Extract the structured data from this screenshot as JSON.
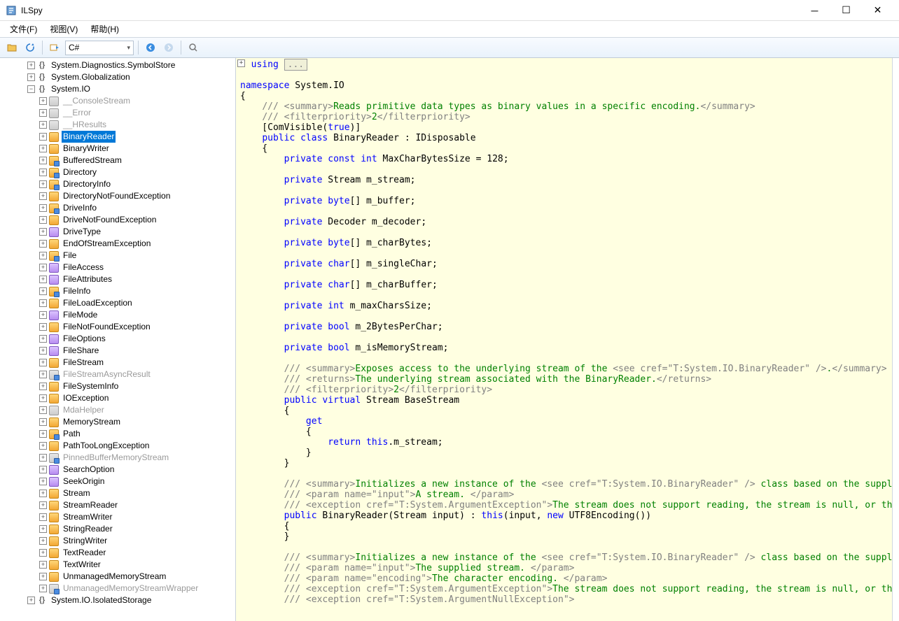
{
  "window": {
    "title": "ILSpy"
  },
  "menu": {
    "file": "文件(F)",
    "view": "视图(V)",
    "help": "帮助(H)"
  },
  "toolbar": {
    "open": "Open",
    "refresh": "Refresh",
    "goto": "Goto",
    "lang_combo": "C#",
    "back": "Back",
    "forward": "Forward",
    "search": "Search"
  },
  "tree": {
    "ns1": "System.Diagnostics.SymbolStore",
    "ns2": "System.Globalization",
    "ns3": "System.IO",
    "ns4": "System.IO.IsolatedStorage",
    "items": [
      {
        "id": "__ConsoleStream",
        "label": "__ConsoleStream",
        "internal": true
      },
      {
        "id": "__Error",
        "label": "__Error",
        "internal": true
      },
      {
        "id": "__HResults",
        "label": "__HResults",
        "internal": true
      },
      {
        "id": "BinaryReader",
        "label": "BinaryReader",
        "selected": true
      },
      {
        "id": "BinaryWriter",
        "label": "BinaryWriter"
      },
      {
        "id": "BufferedStream",
        "label": "BufferedStream",
        "sealed": true
      },
      {
        "id": "Directory",
        "label": "Directory",
        "sealed": true
      },
      {
        "id": "DirectoryInfo",
        "label": "DirectoryInfo",
        "sealed": true
      },
      {
        "id": "DirectoryNotFoundException",
        "label": "DirectoryNotFoundException"
      },
      {
        "id": "DriveInfo",
        "label": "DriveInfo",
        "sealed": true
      },
      {
        "id": "DriveNotFoundException",
        "label": "DriveNotFoundException"
      },
      {
        "id": "DriveType",
        "label": "DriveType",
        "enum": true
      },
      {
        "id": "EndOfStreamException",
        "label": "EndOfStreamException"
      },
      {
        "id": "File",
        "label": "File",
        "sealed": true
      },
      {
        "id": "FileAccess",
        "label": "FileAccess",
        "enum": true
      },
      {
        "id": "FileAttributes",
        "label": "FileAttributes",
        "enum": true
      },
      {
        "id": "FileInfo",
        "label": "FileInfo",
        "sealed": true
      },
      {
        "id": "FileLoadException",
        "label": "FileLoadException"
      },
      {
        "id": "FileMode",
        "label": "FileMode",
        "enum": true
      },
      {
        "id": "FileNotFoundException",
        "label": "FileNotFoundException"
      },
      {
        "id": "FileOptions",
        "label": "FileOptions",
        "enum": true
      },
      {
        "id": "FileShare",
        "label": "FileShare",
        "enum": true
      },
      {
        "id": "FileStream",
        "label": "FileStream"
      },
      {
        "id": "FileStreamAsyncResult",
        "label": "FileStreamAsyncResult",
        "internal": true,
        "sealed": true
      },
      {
        "id": "FileSystemInfo",
        "label": "FileSystemInfo"
      },
      {
        "id": "IOException",
        "label": "IOException"
      },
      {
        "id": "MdaHelper",
        "label": "MdaHelper",
        "internal": true
      },
      {
        "id": "MemoryStream",
        "label": "MemoryStream"
      },
      {
        "id": "Path",
        "label": "Path",
        "sealed": true
      },
      {
        "id": "PathTooLongException",
        "label": "PathTooLongException"
      },
      {
        "id": "PinnedBufferMemoryStream",
        "label": "PinnedBufferMemoryStream",
        "internal": true,
        "sealed": true
      },
      {
        "id": "SearchOption",
        "label": "SearchOption",
        "enum": true
      },
      {
        "id": "SeekOrigin",
        "label": "SeekOrigin",
        "enum": true
      },
      {
        "id": "Stream",
        "label": "Stream"
      },
      {
        "id": "StreamReader",
        "label": "StreamReader"
      },
      {
        "id": "StreamWriter",
        "label": "StreamWriter"
      },
      {
        "id": "StringReader",
        "label": "StringReader"
      },
      {
        "id": "StringWriter",
        "label": "StringWriter"
      },
      {
        "id": "TextReader",
        "label": "TextReader"
      },
      {
        "id": "TextWriter",
        "label": "TextWriter"
      },
      {
        "id": "UnmanagedMemoryStream",
        "label": "UnmanagedMemoryStream"
      },
      {
        "id": "UnmanagedMemoryStreamWrapper",
        "label": "UnmanagedMemoryStreamWrapper",
        "internal": true,
        "sealed": true
      }
    ]
  },
  "code": {
    "using": "using",
    "box": "...",
    "ns_kw": "namespace",
    "ns_name": "System.IO",
    "summary1": "Reads primitive data types as binary values in a specific encoding.",
    "filterpriority": "2",
    "attr": "ComVisible",
    "attr_val": "true",
    "class_decl_public": "public",
    "class_decl_class": "class",
    "class_name": "BinaryReader",
    "class_impl": "IDisposable",
    "const_name": "MaxCharBytesSize",
    "const_val": "128",
    "f_stream": "m_stream",
    "f_buffer": "m_buffer",
    "f_decoder": "m_decoder",
    "f_charBytes": "m_charBytes",
    "f_singleChar": "m_singleChar",
    "f_charBuffer": "m_charBuffer",
    "f_maxCharsSize": "m_maxCharsSize",
    "f_2Bytes": "m_2BytesPerChar",
    "f_isMem": "m_isMemoryStream",
    "summary2": "Exposes access to the underlying stream of the ",
    "cref_br": "T:System.IO.BinaryReader",
    "returns2": "The underlying stream associated with the BinaryReader.",
    "prop_name": "BaseStream",
    "ret_expr": "m_stream",
    "summary3": "Initializes a new instance of the ",
    "summary3_tail": " class based on the supplied stream",
    "param_input": "A stream. ",
    "cref_argex": "T:System.ArgumentException",
    "exc_text": "The stream does not support reading, the stream is null, or the stream i",
    "ctor_sig_type": "Stream",
    "ctor_sig_param": "input",
    "utf8": "UTF8Encoding",
    "param_input2": "The supplied stream. ",
    "param_encoding": "The character encoding. ",
    "cref_argnull": "T:System.ArgumentNullException",
    "kw": {
      "private": "private",
      "const": "const",
      "int": "int",
      "byte": "byte",
      "char": "char",
      "bool": "bool",
      "public": "public",
      "virtual": "virtual",
      "class": "class",
      "namespace": "namespace",
      "using": "using",
      "get": "get",
      "return": "return",
      "this": "this",
      "new": "new",
      "true": "true"
    },
    "ty": {
      "Stream": "Stream",
      "Decoder": "Decoder",
      "BinaryReader": "BinaryReader",
      "IDisposable": "IDisposable"
    }
  }
}
